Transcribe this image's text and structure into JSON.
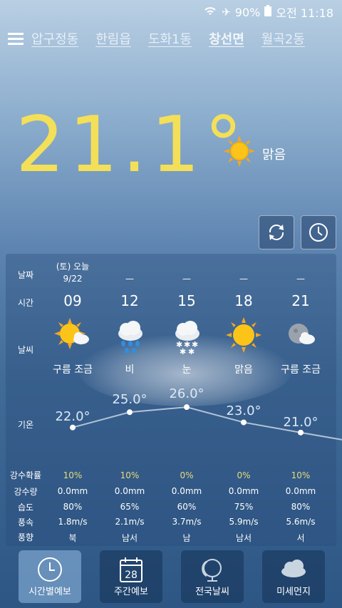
{
  "status": {
    "battery": "90%",
    "time": "오전 11:18"
  },
  "tabs": [
    "압구정동",
    "한림읍",
    "도화1동",
    "창선면",
    "월곡2동"
  ],
  "active_tab": 3,
  "current": {
    "temp": "21.1",
    "degree": "°",
    "condition": "맑음"
  },
  "forecast": {
    "labels": {
      "date": "날짜",
      "time": "시간",
      "weather": "날씨",
      "temp": "기온",
      "pop": "강수확률",
      "rain": "강수량",
      "humidity": "습도",
      "wind_speed": "풍속",
      "wind_dir": "풍향"
    },
    "columns": [
      {
        "date_day": "(토) 오늘",
        "date": "9/22",
        "hour": "09",
        "cond": "구름 조금",
        "icon": "partly-cloudy-icon",
        "temp": "22.0°",
        "temp_val": 22.0,
        "pop": "10%",
        "rain": "0.0mm",
        "humidity": "80%",
        "wind_speed": "1.8m/s",
        "wind_dir": "북"
      },
      {
        "date_day": "",
        "date": "—",
        "hour": "12",
        "cond": "비",
        "icon": "rain-icon",
        "temp": "25.0°",
        "temp_val": 25.0,
        "pop": "10%",
        "rain": "0.0mm",
        "humidity": "65%",
        "wind_speed": "2.1m/s",
        "wind_dir": "남서"
      },
      {
        "date_day": "",
        "date": "—",
        "hour": "15",
        "cond": "눈",
        "icon": "snow-icon",
        "temp": "26.0°",
        "temp_val": 26.0,
        "pop": "0%",
        "rain": "0.0mm",
        "humidity": "60%",
        "wind_speed": "3.7m/s",
        "wind_dir": "남"
      },
      {
        "date_day": "",
        "date": "—",
        "hour": "18",
        "cond": "맑음",
        "icon": "sun-icon",
        "temp": "23.0°",
        "temp_val": 23.0,
        "pop": "0%",
        "rain": "0.0mm",
        "humidity": "75%",
        "wind_speed": "5.9m/s",
        "wind_dir": "남서"
      },
      {
        "date_day": "",
        "date": "—",
        "hour": "21",
        "cond": "구름 조금",
        "icon": "moon-cloud-icon",
        "temp": "21.0°",
        "temp_val": 21.0,
        "pop": "10%",
        "rain": "0.0mm",
        "humidity": "80%",
        "wind_speed": "5.6m/s",
        "wind_dir": "서"
      }
    ]
  },
  "bottom_nav": [
    {
      "label": "시간별예보",
      "icon": "clock-icon"
    },
    {
      "label": "주간예보",
      "icon": "calendar-icon",
      "icon_text": "28"
    },
    {
      "label": "전국날씨",
      "icon": "globe-icon"
    },
    {
      "label": "미세먼지",
      "icon": "cloud-icon"
    }
  ],
  "colors": {
    "temp_yellow": "#f3df58",
    "pop_yellow": "#e8dc7a"
  }
}
